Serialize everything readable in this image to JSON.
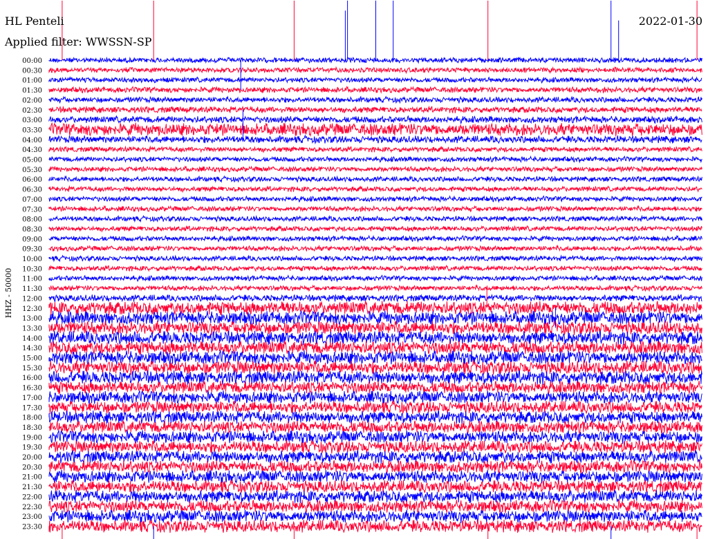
{
  "header": {
    "station": "HL Penteli",
    "date": "2022-01-30",
    "filter": "Applied filter: WWSSN-SP"
  },
  "axis": {
    "ylabel": "HHZ - 50000"
  },
  "colors": {
    "blue": "#0000ff",
    "red": "#ff0033",
    "background": "#ffffff",
    "text": "#000000"
  },
  "chart_data": {
    "type": "line",
    "description_of_series": "alternating blue/red seismic traces",
    "rows": [
      {
        "time": "00:00",
        "color": "blue",
        "noise": 1.0
      },
      {
        "time": "00:30",
        "color": "red",
        "noise": 1.0
      },
      {
        "time": "01:00",
        "color": "blue",
        "noise": 1.0
      },
      {
        "time": "01:30",
        "color": "red",
        "noise": 1.1
      },
      {
        "time": "02:00",
        "color": "blue",
        "noise": 1.1
      },
      {
        "time": "02:30",
        "color": "red",
        "noise": 1.2
      },
      {
        "time": "03:00",
        "color": "blue",
        "noise": 1.3
      },
      {
        "time": "03:30",
        "color": "red",
        "noise": 2.4
      },
      {
        "time": "04:00",
        "color": "blue",
        "noise": 1.4
      },
      {
        "time": "04:30",
        "color": "red",
        "noise": 1.0
      },
      {
        "time": "05:00",
        "color": "blue",
        "noise": 1.0
      },
      {
        "time": "05:30",
        "color": "red",
        "noise": 1.0
      },
      {
        "time": "06:00",
        "color": "blue",
        "noise": 1.0
      },
      {
        "time": "06:30",
        "color": "red",
        "noise": 1.0
      },
      {
        "time": "07:00",
        "color": "blue",
        "noise": 1.0
      },
      {
        "time": "07:30",
        "color": "red",
        "noise": 1.0
      },
      {
        "time": "08:00",
        "color": "blue",
        "noise": 1.0
      },
      {
        "time": "08:30",
        "color": "red",
        "noise": 1.0
      },
      {
        "time": "09:00",
        "color": "blue",
        "noise": 1.0
      },
      {
        "time": "09:30",
        "color": "red",
        "noise": 1.0
      },
      {
        "time": "10:00",
        "color": "blue",
        "noise": 1.0
      },
      {
        "time": "10:30",
        "color": "red",
        "noise": 1.0
      },
      {
        "time": "11:00",
        "color": "blue",
        "noise": 1.0
      },
      {
        "time": "11:30",
        "color": "red",
        "noise": 1.0
      },
      {
        "time": "12:00",
        "color": "blue",
        "noise": 1.3
      },
      {
        "time": "12:30",
        "color": "red",
        "noise": 2.6
      },
      {
        "time": "13:00",
        "color": "blue",
        "noise": 2.6
      },
      {
        "time": "13:30",
        "color": "red",
        "noise": 2.6
      },
      {
        "time": "14:00",
        "color": "blue",
        "noise": 2.6
      },
      {
        "time": "14:30",
        "color": "red",
        "noise": 2.6
      },
      {
        "time": "15:00",
        "color": "blue",
        "noise": 2.6
      },
      {
        "time": "15:30",
        "color": "red",
        "noise": 2.6
      },
      {
        "time": "16:00",
        "color": "blue",
        "noise": 2.6
      },
      {
        "time": "16:30",
        "color": "red",
        "noise": 2.4
      },
      {
        "time": "17:00",
        "color": "blue",
        "noise": 2.4
      },
      {
        "time": "17:30",
        "color": "red",
        "noise": 2.4
      },
      {
        "time": "18:00",
        "color": "blue",
        "noise": 2.4
      },
      {
        "time": "18:30",
        "color": "red",
        "noise": 2.4
      },
      {
        "time": "19:00",
        "color": "blue",
        "noise": 2.4
      },
      {
        "time": "19:30",
        "color": "red",
        "noise": 2.4
      },
      {
        "time": "20:00",
        "color": "blue",
        "noise": 2.4
      },
      {
        "time": "20:30",
        "color": "red",
        "noise": 2.4
      },
      {
        "time": "21:00",
        "color": "blue",
        "noise": 2.4
      },
      {
        "time": "21:30",
        "color": "red",
        "noise": 2.4
      },
      {
        "time": "22:00",
        "color": "blue",
        "noise": 2.4
      },
      {
        "time": "22:30",
        "color": "red",
        "noise": 2.4
      },
      {
        "time": "23:00",
        "color": "blue",
        "noise": 2.4
      },
      {
        "time": "23:30",
        "color": "red",
        "noise": 2.4
      }
    ],
    "spikes": [
      {
        "row": 0,
        "minute": 1.2,
        "amp": -6,
        "color": "red"
      },
      {
        "row": 0,
        "minute": 9.6,
        "amp": -6,
        "color": "red"
      },
      {
        "row": 0,
        "minute": 22.5,
        "amp": -6,
        "color": "red"
      },
      {
        "row": 0,
        "minute": 27.2,
        "amp": -5,
        "color": "blue"
      },
      {
        "row": 0,
        "minute": 27.4,
        "amp": -6,
        "color": "blue"
      },
      {
        "row": 0,
        "minute": 30.0,
        "amp": -6,
        "color": "blue"
      },
      {
        "row": 0,
        "minute": 31.6,
        "amp": -6,
        "color": "blue"
      },
      {
        "row": 0,
        "minute": 40.3,
        "amp": -6,
        "color": "red"
      },
      {
        "row": 0,
        "minute": 51.6,
        "amp": -6,
        "color": "blue"
      },
      {
        "row": 0,
        "minute": 52.3,
        "amp": -4,
        "color": "blue"
      },
      {
        "row": 0,
        "minute": 59.5,
        "amp": -6,
        "color": "red"
      },
      {
        "row": 3,
        "minute": 17.6,
        "amp": -3,
        "color": "blue"
      },
      {
        "row": 5,
        "minute": 17.8,
        "amp": 3,
        "color": "blue"
      },
      {
        "row": 23,
        "minute": 40.2,
        "amp": 2,
        "color": "red"
      },
      {
        "row": 25,
        "minute": 46.5,
        "amp": 2,
        "color": "blue"
      },
      {
        "row": 47,
        "minute": 1.2,
        "amp": 3,
        "color": "red"
      },
      {
        "row": 47,
        "minute": 9.6,
        "amp": 3,
        "color": "blue"
      },
      {
        "row": 47,
        "minute": 22.5,
        "amp": 3,
        "color": "red"
      },
      {
        "row": 47,
        "minute": 40.3,
        "amp": 3,
        "color": "red"
      },
      {
        "row": 47,
        "minute": 51.6,
        "amp": 3,
        "color": "blue"
      },
      {
        "row": 47,
        "minute": 59.5,
        "amp": 3,
        "color": "red"
      }
    ]
  }
}
